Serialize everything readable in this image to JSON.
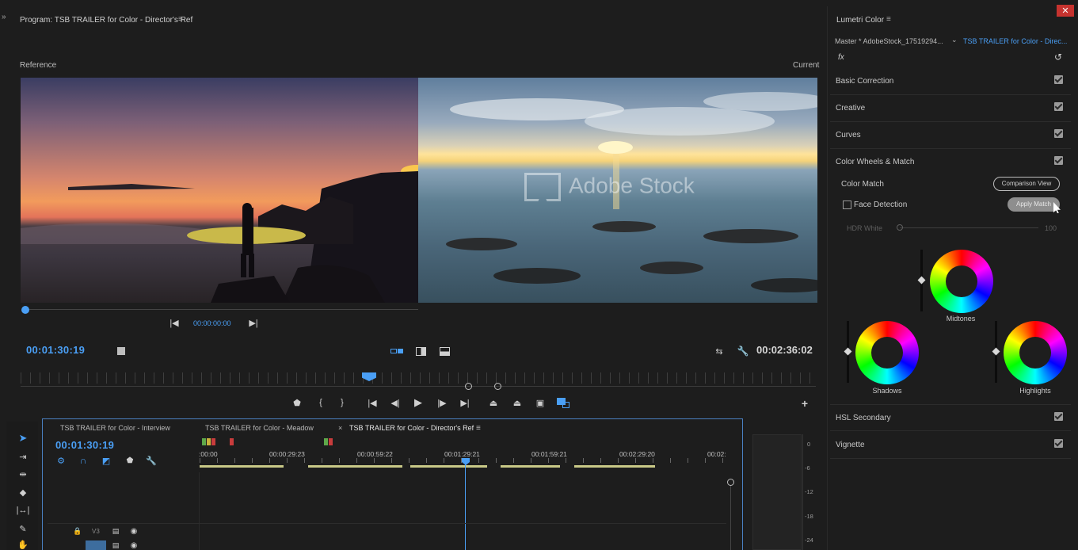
{
  "program_monitor": {
    "title": "Program: TSB TRAILER for Color - Director's Ref",
    "reference_label": "Reference",
    "current_label": "Current",
    "reference_timecode": "00:00:00:00",
    "playhead_timecode": "00:01:30:19",
    "duration_timecode": "00:02:36:02",
    "watermark": "Adobe Stock"
  },
  "lumetri": {
    "title": "Lumetri Color",
    "master_clip": "Master * AdobeStock_17519294...",
    "sequence_clip": "TSB TRAILER for Color - Direc...",
    "fx_label": "fx",
    "sections": [
      {
        "label": "Basic Correction",
        "checked": true
      },
      {
        "label": "Creative",
        "checked": true
      },
      {
        "label": "Curves",
        "checked": true
      },
      {
        "label": "Color Wheels & Match",
        "checked": true
      }
    ],
    "color_match_label": "Color Match",
    "comparison_view_button": "Comparison View",
    "face_detection_label": "Face Detection",
    "apply_match_button": "Apply Match",
    "hdr_white_label": "HDR White",
    "hdr_white_value": "100",
    "wheels": {
      "midtones": "Midtones",
      "shadows": "Shadows",
      "highlights": "Highlights"
    },
    "bottom_sections": [
      {
        "label": "HSL Secondary",
        "checked": true
      },
      {
        "label": "Vignette",
        "checked": true
      }
    ]
  },
  "timeline": {
    "tabs": [
      {
        "label": "TSB TRAILER for Color - Interview"
      },
      {
        "label": "TSB TRAILER for Color - Meadow"
      },
      {
        "label": "TSB TRAILER for Color - Director's Ref"
      }
    ],
    "tab_close": "×",
    "timecode": "00:01:30:19",
    "ruler_labels": [
      ":00:00",
      "00:00:29:23",
      "00:00:59:22",
      "00:01:29:21",
      "00:01:59:21",
      "00:02:29:20",
      "00:02:"
    ],
    "tracks": [
      {
        "name": "V3"
      }
    ]
  },
  "audio_meter": {
    "levels": [
      "0",
      "-6",
      "-12",
      "-18",
      "-24"
    ]
  },
  "colors": {
    "accent": "#4a9ff5",
    "panel_bg": "#1d1d1d",
    "clip_bar": "#c9c987"
  }
}
